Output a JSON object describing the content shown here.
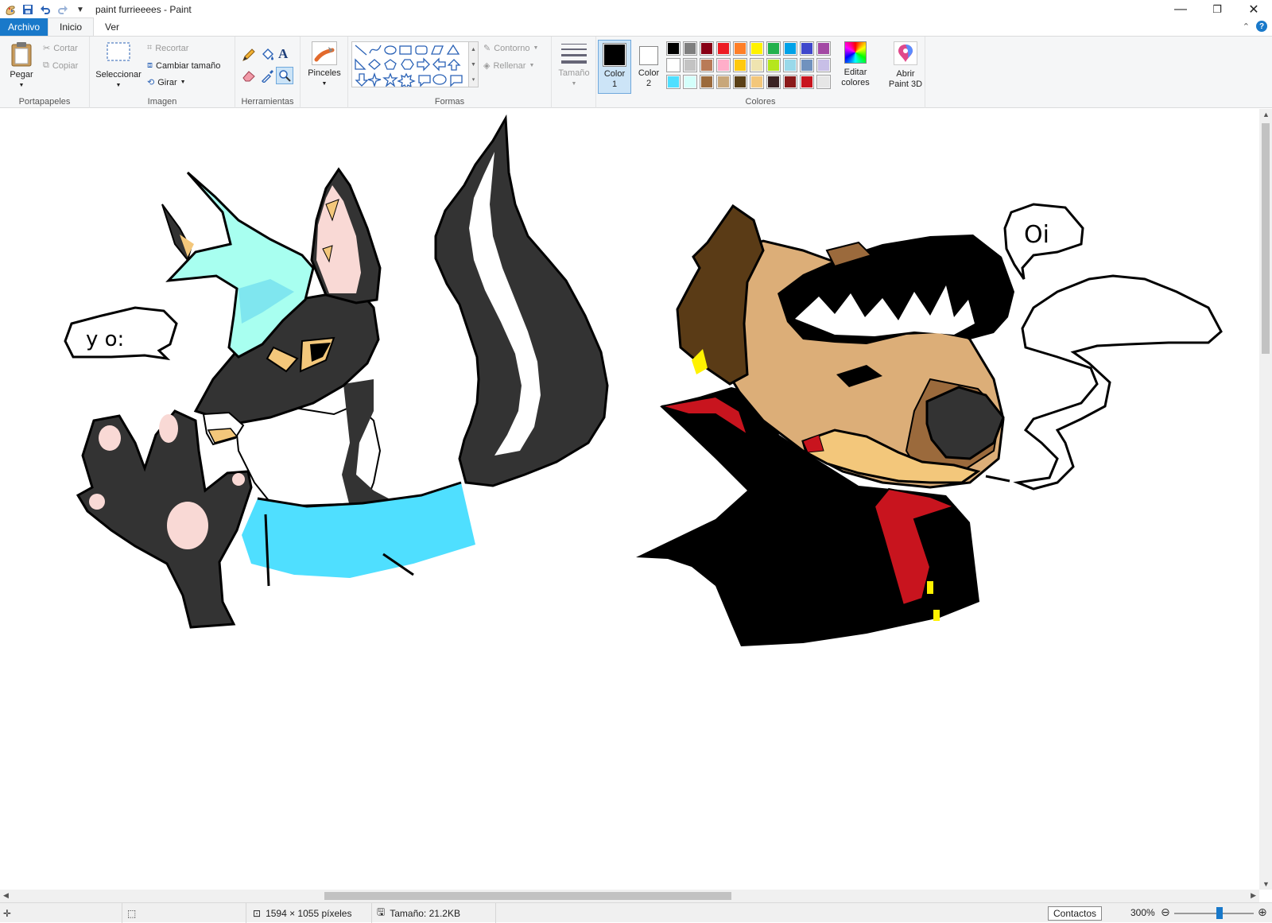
{
  "window": {
    "title": "paint furrieeees - Paint"
  },
  "quick_access": {
    "icons": [
      "paint-app-icon",
      "save-icon",
      "undo-icon",
      "redo-icon",
      "customize-dropdown-icon"
    ]
  },
  "tabs": {
    "file": "Archivo",
    "home": "Inicio",
    "view": "Ver"
  },
  "ribbon": {
    "clipboard": {
      "label": "Portapapeles",
      "paste": "Pegar",
      "cut": "Cortar",
      "copy": "Copiar"
    },
    "image": {
      "label": "Imagen",
      "select": "Seleccionar",
      "crop": "Recortar",
      "resize": "Cambiar tamaño",
      "rotate": "Girar"
    },
    "tools": {
      "label": "Herramientas"
    },
    "brushes": {
      "label": "Pinceles"
    },
    "shapes": {
      "label": "Formas",
      "outline": "Contorno",
      "fill": "Rellenar"
    },
    "size": {
      "label": "Tamaño"
    },
    "colors": {
      "label": "Colores",
      "color1": "Color 1",
      "color2": "Color 2",
      "edit": "Editar colores",
      "color1_value": "#000000",
      "color2_value": "#ffffff",
      "palette": [
        [
          "#000000",
          "#7f7f7f",
          "#880015",
          "#ed1c24",
          "#ff7f27",
          "#fff200",
          "#22b14c",
          "#00a2e8",
          "#3f48cc",
          "#a349a4"
        ],
        [
          "#ffffff",
          "#c3c3c3",
          "#b97a57",
          "#ffaec9",
          "#ffc90e",
          "#efe4b0",
          "#b5e61d",
          "#99d9ea",
          "#7092be",
          "#c8bfe7"
        ],
        [
          "#4fdfff",
          "#d4fffb",
          "#9b6a3c",
          "#c8a77a",
          "#5a4016",
          "#f3c77b",
          "#3a2323",
          "#8b1a1a",
          "#c8141e",
          "#e6e6e6"
        ]
      ]
    },
    "paint3d": {
      "label": "Abrir Paint 3D"
    }
  },
  "canvas": {
    "speech_left": "y o:",
    "speech_right": "Oi"
  },
  "statusbar": {
    "dimensions": "1594 × 1055 píxeles",
    "size": "Tamaño: 21.2KB",
    "contacts": "Contactos",
    "zoom": "300%"
  }
}
